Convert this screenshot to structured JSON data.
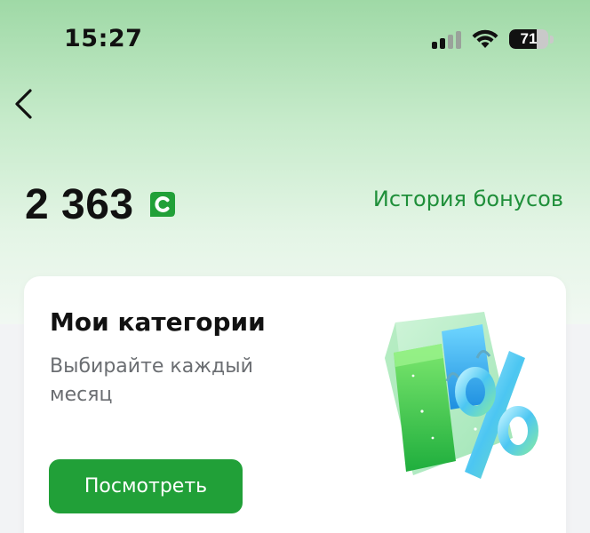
{
  "status_bar": {
    "time": "15:27",
    "battery_percent": "71",
    "battery_level": 0.71
  },
  "header": {
    "back_icon": "chevron-left-icon"
  },
  "balance": {
    "value": "2 363",
    "icon": "sber-bonus-icon",
    "history_label": "История бонусов"
  },
  "categories_card": {
    "title": "Мои категории",
    "subtitle": "Выбирайте каждый месяц",
    "button_label": "Посмотреть",
    "illustration": "shopping-bag-percent-icon"
  },
  "colors": {
    "accent": "#21a038",
    "link": "#1f8f3a",
    "header_gradient_top": "#9fd9a6",
    "background": "#f2f3f5"
  }
}
